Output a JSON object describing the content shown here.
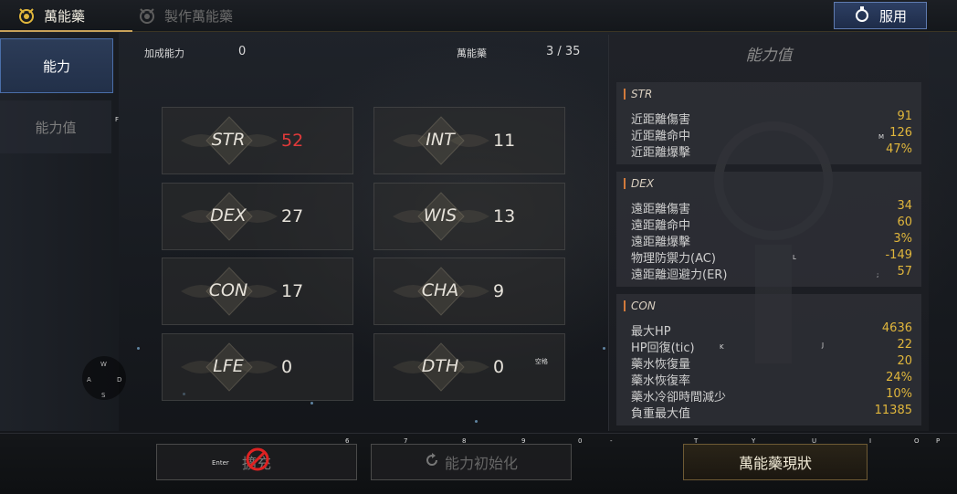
{
  "top": {
    "tab_active": "萬能藥",
    "tab_inactive": "製作萬能藥",
    "use_button": "服用"
  },
  "left_menu": {
    "item_ability": "能力",
    "item_ability_value": "能力值",
    "hint_f": "F"
  },
  "header": {
    "bonus_label": "加成能力",
    "bonus_value": "0",
    "elixir_label": "萬能藥",
    "elixir_count": "3 / 35"
  },
  "stats": [
    {
      "name": "STR",
      "value": "52",
      "highlight": "#e23a3a"
    },
    {
      "name": "INT",
      "value": "11"
    },
    {
      "name": "DEX",
      "value": "27"
    },
    {
      "name": "WIS",
      "value": "13"
    },
    {
      "name": "CON",
      "value": "17"
    },
    {
      "name": "CHA",
      "value": "9"
    },
    {
      "name": "LFE",
      "value": "0"
    },
    {
      "name": "DTH",
      "value": "0"
    }
  ],
  "panel": {
    "title": "能力值",
    "str": {
      "title": "STR",
      "rows": [
        {
          "label": "近距離傷害",
          "value": "91"
        },
        {
          "label": "近距離命中",
          "value": "126"
        },
        {
          "label": "近距離爆擊",
          "value": "47%"
        }
      ]
    },
    "dex": {
      "title": "DEX",
      "rows": [
        {
          "label": "遠距離傷害",
          "value": "34"
        },
        {
          "label": "遠距離命中",
          "value": "60"
        },
        {
          "label": "遠距離爆擊",
          "value": "3%"
        },
        {
          "label": "物理防禦力(AC)",
          "value": "-149"
        },
        {
          "label": "遠距離迴避力(ER)",
          "value": "57"
        }
      ]
    },
    "con": {
      "title": "CON",
      "rows": [
        {
          "label": "最大HP",
          "value": "4636"
        },
        {
          "label": "HP回復(tic)",
          "value": "22"
        },
        {
          "label": "藥水恢復量",
          "value": "20"
        },
        {
          "label": "藥水恢復率",
          "value": "24%"
        },
        {
          "label": "藥水冷卻時間減少",
          "value": "10%"
        },
        {
          "label": "負重最大值",
          "value": "11385"
        }
      ]
    }
  },
  "bottom": {
    "expand_button": "擴充",
    "reset_button": "能力初始化",
    "status_button": "萬能藥現狀",
    "enter_hint": "Enter"
  },
  "key_hints": {
    "k6": "6",
    "k7": "7",
    "k8": "8",
    "k9": "9",
    "k0": "0",
    "kdash": "-",
    "kt": "T",
    "ky": "Y",
    "ku": "U",
    "ki": "I",
    "ko": "O",
    "kp": "P",
    "m": "M",
    "l": "L",
    "semicolon": ";",
    "k": "K",
    "j": "J",
    "space": "空格",
    "w": "W",
    "a": "A",
    "s": "S",
    "d": "D"
  },
  "colors": {
    "accent_gold": "#e0b63c",
    "accent_blue": "#4a6ea8",
    "stat_highlight": "#e23a3a"
  }
}
